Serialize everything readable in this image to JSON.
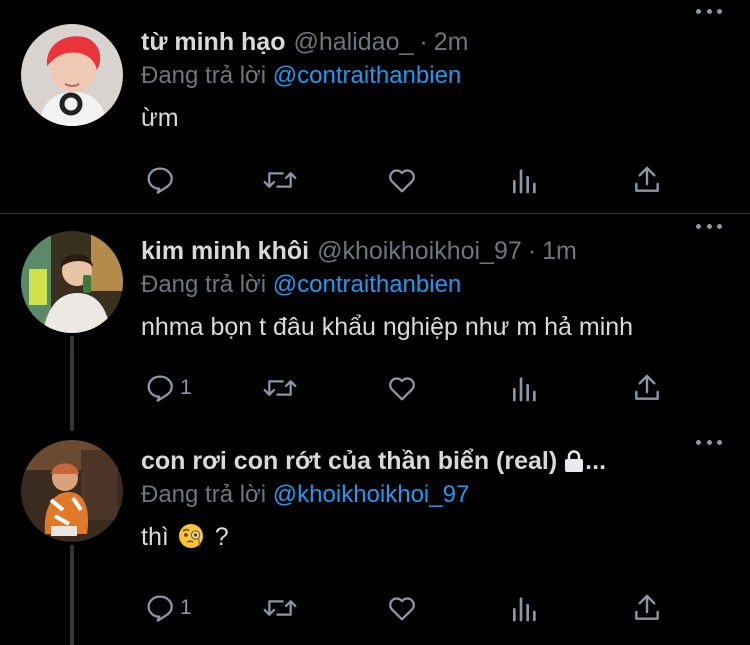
{
  "replying_to_label": "Đang trả lời",
  "tweets": [
    {
      "name": "từ minh hạo",
      "handle": "@halidao_",
      "time": "2m",
      "reply_to": "@contraithanbien",
      "text": "ừm",
      "reply_count": ""
    },
    {
      "name": "kim minh khôi",
      "handle": "@khoikhoikhoi_97",
      "time": "1m",
      "reply_to": "@contraithanbien",
      "text": "nhma bọn t đâu khẩu nghiệp như m hả minh",
      "reply_count": "1"
    },
    {
      "name": "con rơi con rớt của thần biển (real)",
      "ellipsis": "...",
      "handle": "",
      "time": "",
      "reply_to": "@khoikhoikhoi_97",
      "text_before": "thì",
      "text_after": "?",
      "emoji": "face-with-monocle",
      "protected": true,
      "reply_count": "1"
    }
  ],
  "icons": [
    "reply-icon",
    "retweet-icon",
    "like-icon",
    "analytics-icon",
    "share-icon",
    "more-icon",
    "lock-icon"
  ],
  "colors": {
    "background": "#000000",
    "text": "#d9d9d9",
    "muted": "#6e767d",
    "link": "#1d9bf0",
    "icon": "#8b98a5"
  }
}
